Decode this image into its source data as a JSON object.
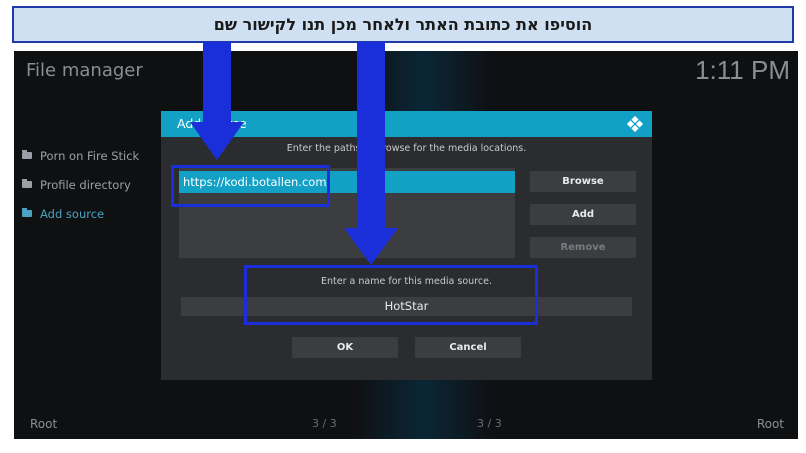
{
  "banner": {
    "text": "הוסיפו את כתובת האתר ולאחר מכן תנו לקישור שם"
  },
  "header": {
    "title": "File manager",
    "clock": "1:11 PM"
  },
  "sidebar": {
    "items": [
      {
        "label": "Porn on Fire Stick",
        "icon": "folder-icon",
        "active": false
      },
      {
        "label": "Profile directory",
        "icon": "folder-icon",
        "active": false
      },
      {
        "label": "Add source",
        "icon": "folder-icon",
        "active": true
      }
    ]
  },
  "footer": {
    "left": "Root",
    "right": "Root",
    "count_left": "3 / 3",
    "count_right": "3 / 3"
  },
  "dialog": {
    "title": "Add source",
    "icon": "kodi-icon",
    "paths_hint": "Enter the paths or browse for the media locations.",
    "path_value": "https://kodi.botallen.com/",
    "browse_label": "Browse",
    "add_label": "Add",
    "remove_label": "Remove",
    "name_hint": "Enter a name for this media source.",
    "name_value": "HotStar",
    "ok_label": "OK",
    "cancel_label": "Cancel"
  },
  "colors": {
    "accent": "#12a0c4",
    "annotation": "#1a2fd9",
    "background": "#0f1012",
    "dialog": "#2b2c2f"
  }
}
